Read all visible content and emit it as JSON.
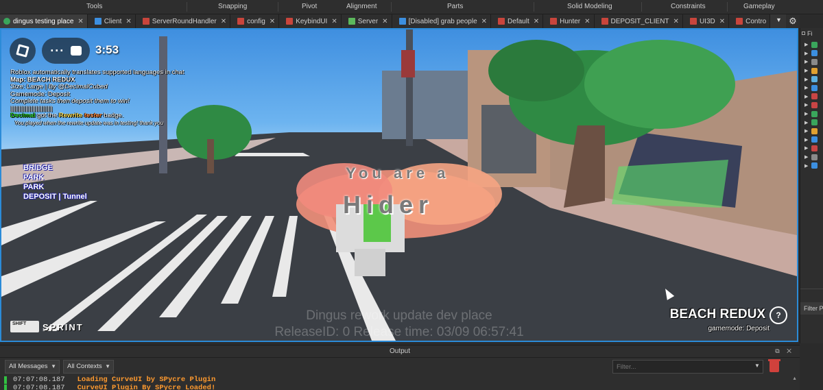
{
  "ribbon": {
    "sections": [
      "Tools",
      "Snapping",
      "Pivot",
      "Alignment",
      "Parts",
      "Solid Modeling",
      "Constraints",
      "Gameplay"
    ]
  },
  "tabs": [
    {
      "label": "dingus testing place",
      "icon": "place-icon",
      "active": true
    },
    {
      "label": "Client",
      "icon": "local-script-icon"
    },
    {
      "label": "ServerRoundHandler",
      "icon": "server-script-icon"
    },
    {
      "label": "config",
      "icon": "server-script-icon"
    },
    {
      "label": "KeybindUI",
      "icon": "server-script-icon"
    },
    {
      "label": "Server",
      "icon": "module-script-icon"
    },
    {
      "label": "[Disabled] grab people",
      "icon": "local-script-icon"
    },
    {
      "label": "Default",
      "icon": "server-script-icon"
    },
    {
      "label": "Hunter",
      "icon": "server-script-icon"
    },
    {
      "label": "DEPOSIT_CLIENT",
      "icon": "server-script-icon"
    },
    {
      "label": "UI3D",
      "icon": "server-script-icon"
    },
    {
      "label": "Contro",
      "icon": "server-script-icon"
    }
  ],
  "game": {
    "timer": "3:53",
    "chat": [
      {
        "text": "Roblox automatically translates supported languages in chat"
      },
      {
        "text": "Map: BEACH REDUX"
      },
      {
        "text": "Size: Large | By @DecimalCubed"
      },
      {
        "text": "Gamemode: Deposit"
      },
      {
        "text": "Complete tasks then deposit them to win!"
      },
      {
        "text": "|||||||||||||||||||||||||"
      }
    ],
    "badge": {
      "name": "Decimal",
      "mid1": " got the ",
      "rewrite": "Rewrite",
      "tester": "tester",
      "end": " badge."
    },
    "badge_note": "You played when the rewrite update was in testing! thank you",
    "waypoints": [
      "BRIDGE",
      "PARK",
      "PARK",
      "DEPOSIT | Tunnel"
    ],
    "center_line1": "You are a",
    "center_line2": "Hider",
    "watermark_line1": "Dingus rework update dev place",
    "watermark_line2": "ReleaseID: 0 Release time: 03/09 06:57:41",
    "sprint_key": "SHIFT",
    "sprint_label": "SPRINT",
    "map_name": "BEACH REDUX",
    "gamemode": "gamemode: Deposit"
  },
  "explorer": {
    "header": "Fi",
    "filter_label": "Filter P",
    "row_icon_colors": [
      "#3aa65c",
      "#3c8fe0",
      "#8a8a8a",
      "#e0a030",
      "#5db0e0",
      "#3c8fe0",
      "#c84545",
      "#c84545",
      "#3aa65c",
      "#3aa65c",
      "#e0a030",
      "#3c8fe0",
      "#c84545",
      "#8a8a8a",
      "#3c8fe0"
    ]
  },
  "output": {
    "title": "Output",
    "messages_filter": "All Messages",
    "contexts_filter": "All Contexts",
    "filter_placeholder": "Filter...",
    "lines": [
      {
        "time": "07:07:08.187",
        "msg": "Loading CurveUI by SPycre Plugin"
      },
      {
        "time": "07:07:08.187",
        "msg": "CurveUI Plugin By SPycre Loaded!"
      }
    ]
  }
}
